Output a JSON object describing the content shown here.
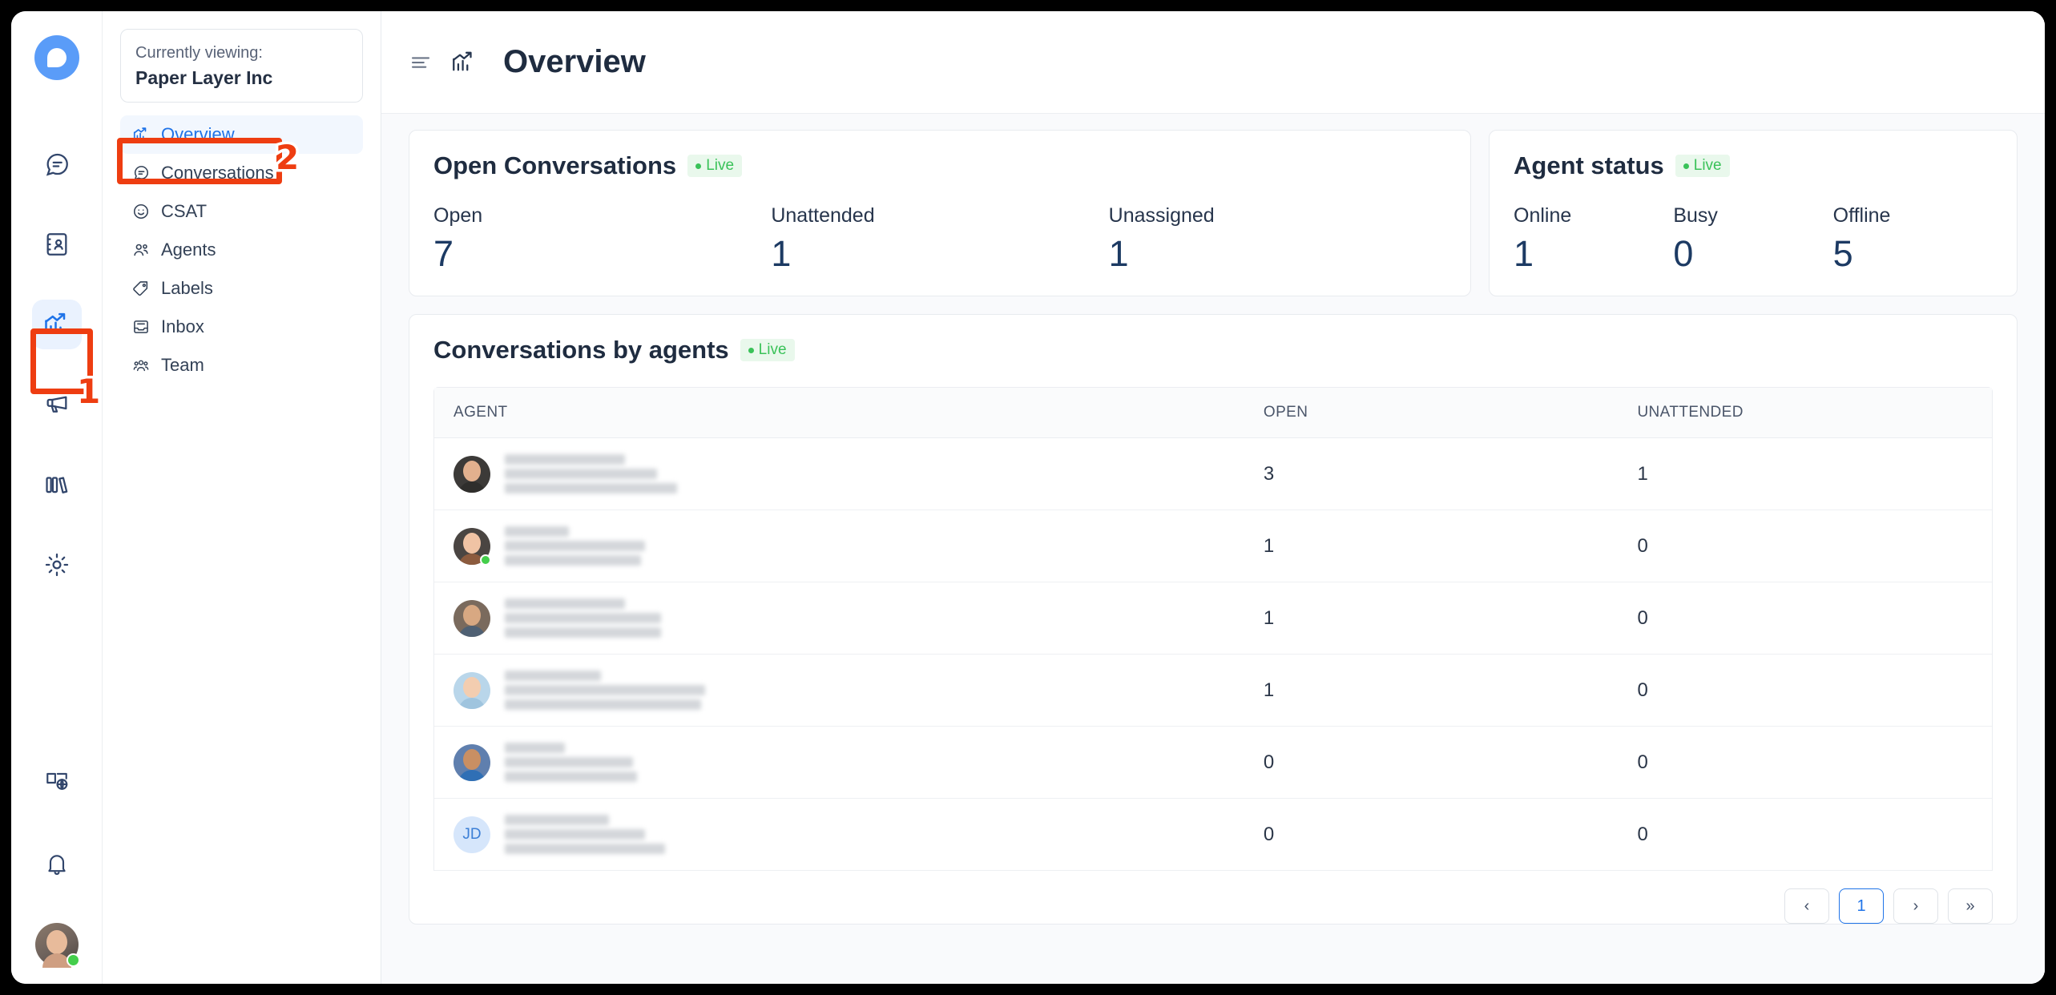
{
  "rail": {
    "brand_icon": "chatwoot-logo-icon",
    "top_items": [
      {
        "icon": "conversations-chat-icon",
        "name": "conversations",
        "active": false
      },
      {
        "icon": "contacts-book-icon",
        "name": "contacts",
        "active": false
      },
      {
        "icon": "reports-chart-icon",
        "name": "reports",
        "active": true
      },
      {
        "icon": "campaigns-megaphone-icon",
        "name": "campaigns",
        "active": false
      },
      {
        "icon": "help-center-books-icon",
        "name": "help-center",
        "active": false
      },
      {
        "icon": "settings-gear-icon",
        "name": "settings",
        "active": false
      }
    ],
    "bottom_items": [
      {
        "icon": "portal-globe-icon",
        "name": "portal"
      },
      {
        "icon": "notifications-bell-icon",
        "name": "notifications"
      }
    ],
    "avatar_status": "online"
  },
  "sidebar": {
    "viewing_label": "Currently viewing:",
    "viewing_account": "Paper Layer Inc",
    "items": [
      {
        "label": "Overview",
        "icon": "reports-chart-icon",
        "active": true
      },
      {
        "label": "Conversations",
        "icon": "chat-bubble-icon",
        "active": false
      },
      {
        "label": "CSAT",
        "icon": "smiley-face-icon",
        "active": false
      },
      {
        "label": "Agents",
        "icon": "people-icon",
        "active": false
      },
      {
        "label": "Labels",
        "icon": "tag-icon",
        "active": false
      },
      {
        "label": "Inbox",
        "icon": "inbox-tray-icon",
        "active": false
      },
      {
        "label": "Team",
        "icon": "team-group-icon",
        "active": false
      }
    ]
  },
  "header": {
    "menu_icon": "hamburger-menu-icon",
    "page_icon": "reports-chart-icon",
    "title": "Overview"
  },
  "open_conversations": {
    "title": "Open Conversations",
    "live_label": "Live",
    "metrics": [
      {
        "label": "Open",
        "value": "7"
      },
      {
        "label": "Unattended",
        "value": "1"
      },
      {
        "label": "Unassigned",
        "value": "1"
      }
    ]
  },
  "agent_status": {
    "title": "Agent status",
    "live_label": "Live",
    "metrics": [
      {
        "label": "Online",
        "value": "1"
      },
      {
        "label": "Busy",
        "value": "0"
      },
      {
        "label": "Offline",
        "value": "5"
      }
    ]
  },
  "conversations_by_agents": {
    "title": "Conversations by agents",
    "live_label": "Live",
    "columns": [
      "AGENT",
      "OPEN",
      "UNATTENDED"
    ],
    "rows": [
      {
        "agent_name": "",
        "avatar_type": "photo",
        "avatar_skin": "#e2b08e",
        "avatar_bg": "#3c3a38",
        "avatar_body": "#2f2e2c",
        "status": "",
        "open": "3",
        "unattended": "1",
        "bars": [
          150,
          190,
          215
        ]
      },
      {
        "agent_name": "",
        "avatar_type": "photo",
        "avatar_skin": "#f0c3a4",
        "avatar_bg": "#4a4542",
        "avatar_body": "#8c5b3e",
        "status": "online",
        "open": "1",
        "unattended": "0",
        "bars": [
          80,
          175,
          170
        ]
      },
      {
        "agent_name": "",
        "avatar_type": "photo",
        "avatar_skin": "#d8a882",
        "avatar_bg": "#7a6a5d",
        "avatar_body": "#4f6073",
        "status": "",
        "open": "1",
        "unattended": "0",
        "bars": [
          150,
          195,
          195
        ]
      },
      {
        "agent_name": "",
        "avatar_type": "photo",
        "avatar_skin": "#f3cdb0",
        "avatar_bg": "#b9d6ea",
        "avatar_body": "#9fc4de",
        "status": "",
        "open": "1",
        "unattended": "0",
        "bars": [
          120,
          250,
          245
        ]
      },
      {
        "agent_name": "",
        "avatar_type": "photo",
        "avatar_skin": "#c98f63",
        "avatar_bg": "#5f7fae",
        "avatar_body": "#2f6fb5",
        "status": "",
        "open": "0",
        "unattended": "0",
        "bars": [
          75,
          160,
          165
        ]
      },
      {
        "agent_name": "",
        "avatar_type": "initials",
        "avatar_initials": "JD",
        "avatar_bg": "#d6e6fb",
        "status": "",
        "open": "0",
        "unattended": "0",
        "bars": [
          130,
          175,
          200
        ]
      }
    ],
    "pagination": {
      "prev": "‹",
      "current": "1",
      "next": "›",
      "last": "»"
    }
  },
  "annotations": [
    {
      "number": "1",
      "target": "reports-rail-icon"
    },
    {
      "number": "2",
      "target": "overview-nav-item"
    }
  ]
}
